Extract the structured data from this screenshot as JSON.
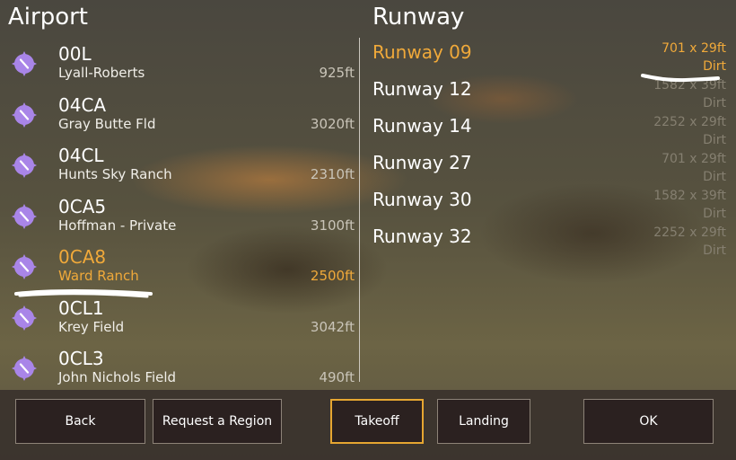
{
  "airport_pane": {
    "title": "Airport",
    "items": [
      {
        "code": "00L",
        "name": "Lyall-Roberts",
        "length": "925ft",
        "selected": false
      },
      {
        "code": "04CA",
        "name": "Gray Butte Fld",
        "length": "3020ft",
        "selected": false
      },
      {
        "code": "04CL",
        "name": "Hunts Sky Ranch",
        "length": "2310ft",
        "selected": false
      },
      {
        "code": "0CA5",
        "name": "Hoffman - Private",
        "length": "3100ft",
        "selected": false
      },
      {
        "code": "0CA8",
        "name": "Ward Ranch",
        "length": "2500ft",
        "selected": true
      },
      {
        "code": "0CL1",
        "name": "Krey Field",
        "length": "3042ft",
        "selected": false
      },
      {
        "code": "0CL3",
        "name": "John Nichols Field",
        "length": "490ft",
        "selected": false
      }
    ]
  },
  "runway_pane": {
    "title": "Runway",
    "items": [
      {
        "name": "Runway 09",
        "dims": "701 x 29ft",
        "surface": "Dirt",
        "selected": true
      },
      {
        "name": "Runway 12",
        "dims": "1582 x 39ft",
        "surface": "Dirt",
        "selected": false
      },
      {
        "name": "Runway 14",
        "dims": "2252 x 29ft",
        "surface": "Dirt",
        "selected": false
      },
      {
        "name": "Runway 27",
        "dims": "701 x 29ft",
        "surface": "Dirt",
        "selected": false
      },
      {
        "name": "Runway 30",
        "dims": "1582 x 39ft",
        "surface": "Dirt",
        "selected": false
      },
      {
        "name": "Runway 32",
        "dims": "2252 x 29ft",
        "surface": "Dirt",
        "selected": false
      }
    ]
  },
  "buttons": {
    "back": "Back",
    "request_region": "Request a Region",
    "takeoff": "Takeoff",
    "landing": "Landing",
    "ok": "OK"
  },
  "colors": {
    "accent": "#f0a93a",
    "airport_icon": "#a985e8",
    "button_bg": "#2b2120",
    "active_border": "#e6a631"
  },
  "icons": {
    "airport": "airport-marker-icon"
  }
}
